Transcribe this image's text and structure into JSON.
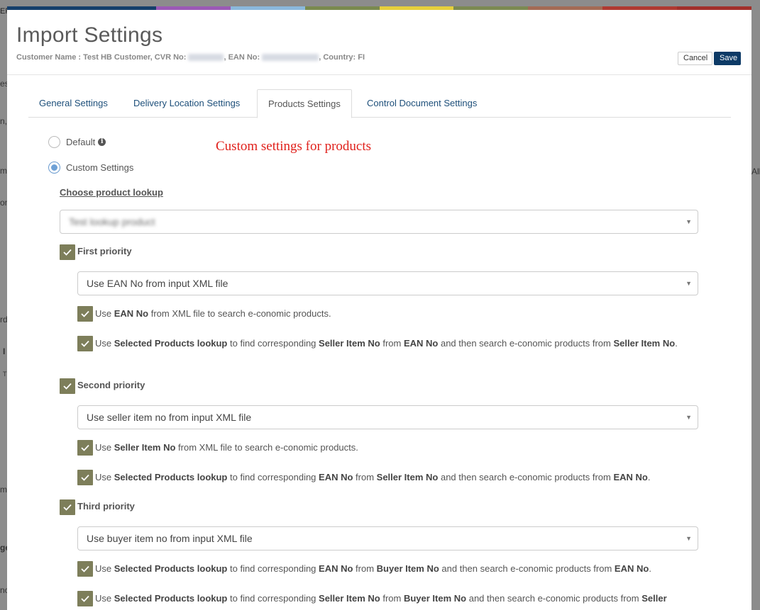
{
  "colors": {
    "colorbar": [
      "#163f6b",
      "#163f6b",
      "#9b59b6",
      "#8bb8dc",
      "#7a8a4f",
      "#e6cf3b",
      "#7c8a52",
      "#a46b55",
      "#b03a31",
      "#a2302b"
    ],
    "accent": "#0d3a66",
    "check": "#7d7e5a",
    "note": "#e0201b"
  },
  "modal": {
    "title": "Import Settings",
    "subtitle": {
      "customer": "Customer Name : Test HB Customer, CVR No:",
      "cvr_value": "32214221",
      "ean_label": ", EAN No:",
      "ean_value": "5790000001234",
      "country": ", Country: FI"
    },
    "buttons": {
      "cancel": "Cancel",
      "save": "Save"
    }
  },
  "tabs": [
    {
      "label": "General Settings",
      "active": false
    },
    {
      "label": "Delivery Location Settings",
      "active": false
    },
    {
      "label": "Products Settings",
      "active": true
    },
    {
      "label": "Control Document Settings",
      "active": false
    }
  ],
  "options": {
    "default_label": "Default",
    "default_info_icon": "info-circle-icon",
    "custom_label": "Custom Settings",
    "note": "Custom settings for products"
  },
  "lookup": {
    "title": "Choose product lookup",
    "value": "Test lookup product"
  },
  "priorities": [
    {
      "label": "First priority",
      "select": "Use EAN No from input XML file",
      "rules": [
        {
          "parts": [
            "Use ",
            "EAN No",
            " from XML file to search e-conomic products."
          ]
        },
        {
          "parts": [
            "Use ",
            "Selected Products lookup",
            " to find corresponding ",
            "Seller Item No",
            " from ",
            "EAN No",
            " and then search e-conomic products from ",
            "Seller Item No",
            "."
          ]
        }
      ]
    },
    {
      "label": "Second priority",
      "select": "Use seller item no from input XML file",
      "rules": [
        {
          "parts": [
            "Use ",
            "Seller Item No",
            " from XML file to search e-conomic products."
          ]
        },
        {
          "parts": [
            "Use ",
            "Selected Products lookup",
            " to find corresponding ",
            "EAN No",
            " from ",
            "Seller Item No",
            " and then search e-conomic products from ",
            "EAN No",
            "."
          ]
        }
      ]
    },
    {
      "label": "Third priority",
      "select": "Use buyer item no from input XML file",
      "rules": [
        {
          "parts": [
            "Use ",
            "Selected Products lookup",
            " to find corresponding ",
            "EAN No",
            " from ",
            "Buyer Item No",
            " and then search e-conomic products from ",
            "EAN No",
            "."
          ]
        },
        {
          "parts": [
            "Use ",
            "Selected Products lookup",
            " to find corresponding ",
            "Seller Item No",
            " from ",
            "Buyer Item No",
            " and then search e-conomic products from ",
            "Seller"
          ]
        }
      ]
    }
  ],
  "background": {
    "fragments": [
      "EP",
      "es",
      "n,",
      "m",
      "on",
      "rd",
      "I",
      "T",
      "All",
      "m",
      "ge",
      "nc"
    ]
  }
}
